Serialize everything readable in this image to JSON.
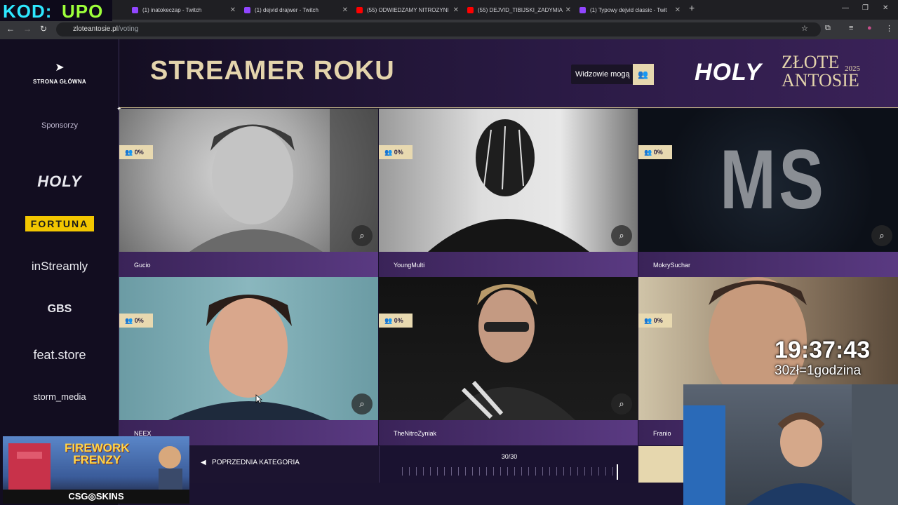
{
  "browser": {
    "tabs": [
      {
        "title": "(1) inatokeczap - Twitch",
        "color": "#9146ff"
      },
      {
        "title": "(1) dejvid drajwer - Twitch",
        "color": "#9146ff"
      },
      {
        "title": "(55) ODWIEDZAMY NITROZYNI",
        "color": "#ff0000"
      },
      {
        "title": "(55) DEJVID_TIBIJSKI_ZADYMIA",
        "color": "#ff0000"
      },
      {
        "title": "(1) Typowy dejvid classic - Twit",
        "color": "#9146ff"
      }
    ],
    "url_host": "zloteantosie.pl",
    "url_path": "/voting"
  },
  "sidebar": {
    "home_label": "STRONA GŁÓWNA",
    "sponsors_title": "Sponsorzy",
    "sponsors": [
      "HOLY",
      "FORTUNA",
      "inStreamly",
      "GBS",
      "feat.store",
      "storm_media"
    ]
  },
  "header": {
    "category_title": "STREAMER ROKU",
    "viewers_label": "Widzowie mogą",
    "brand_holy": "HOLY",
    "brand_line1": "ZŁOTE",
    "brand_line2": "ANTOSIE",
    "brand_year": "2025"
  },
  "nominees": [
    {
      "name": "Gucio",
      "percent": "0%"
    },
    {
      "name": "YoungMulti",
      "percent": "0%"
    },
    {
      "name": "MokrySuchar",
      "percent": "0%"
    },
    {
      "name": "NEEX",
      "percent": "0%"
    },
    {
      "name": "TheNitroZyniak",
      "percent": "0%"
    },
    {
      "name": "Franio",
      "percent": "0%"
    }
  ],
  "nominee_photo_text": {
    "mokrysuchar": "MS"
  },
  "footer": {
    "prev_label": "POPRZEDNIA KATEGORIA",
    "progress_text": "30/30",
    "progress_fraction": 1.0
  },
  "overlay": {
    "logo_left": "KOD:",
    "logo_right": "UPO",
    "ad_title_line1": "FIREWORK",
    "ad_title_line2": "FRENZY",
    "ad_sponsor": "CSG◎SKINS",
    "clock": "19:37:43",
    "rate": "30zł=1godzina"
  },
  "colors": {
    "accent_gold": "#e6d7ae",
    "brand_purple": "#5a3a82"
  }
}
